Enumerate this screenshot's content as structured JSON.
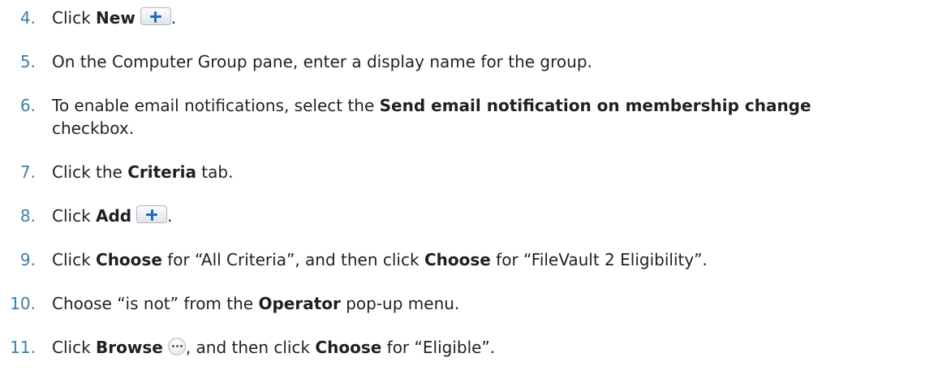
{
  "steps": [
    {
      "num": "4.",
      "pre": "Click ",
      "b1": "New",
      "post": "."
    },
    {
      "num": "5.",
      "text": "On the Computer Group pane, enter a display name for the group."
    },
    {
      "num": "6.",
      "pre": "To enable email notifications, select the ",
      "b1": "Send email notification on membership change",
      "line2": "checkbox."
    },
    {
      "num": "7.",
      "pre": "Click the ",
      "b1": "Criteria",
      "post": " tab."
    },
    {
      "num": "8.",
      "pre": "Click ",
      "b1": "Add",
      "post": "."
    },
    {
      "num": "9.",
      "pre": "Click ",
      "b1": "Choose",
      "mid": " for “All Criteria”, and then click ",
      "b2": "Choose",
      "post": " for “FileVault 2 Eligibility”."
    },
    {
      "num": "10.",
      "pre": "Choose “is not” from the ",
      "b1": "Operator",
      "post": " pop-up menu."
    },
    {
      "num": "11.",
      "pre": "Click ",
      "b1": "Browse",
      "mid": ", and then click ",
      "b2": "Choose",
      "post": " for “Eligible”."
    }
  ],
  "icons": {
    "new": "plus-icon",
    "add": "plus-icon",
    "browse": "ellipsis-icon"
  }
}
